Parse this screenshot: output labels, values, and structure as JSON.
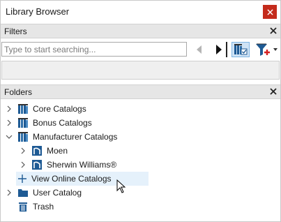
{
  "window": {
    "title": "Library Browser"
  },
  "filters": {
    "header": "Filters",
    "search_placeholder": "Type to start searching..."
  },
  "folders": {
    "header": "Folders",
    "items": [
      {
        "label": "Core Catalogs",
        "expanded": false,
        "icon": "catalog-books-icon"
      },
      {
        "label": "Bonus Catalogs",
        "expanded": false,
        "icon": "catalog-books-icon"
      },
      {
        "label": "Manufacturer Catalogs",
        "expanded": true,
        "icon": "catalog-books-icon"
      },
      {
        "label": "Moen",
        "expanded": false,
        "icon": "manufacturer-icon"
      },
      {
        "label": "Sherwin Williams®",
        "expanded": false,
        "icon": "manufacturer-icon"
      },
      {
        "label": "View Online Catalogs",
        "icon": "plus-icon"
      },
      {
        "label": "User Catalog",
        "expanded": false,
        "icon": "folder-icon"
      },
      {
        "label": "Trash",
        "icon": "trash-icon"
      }
    ]
  },
  "colors": {
    "close_red": "#c42b1c",
    "header_gray": "#e6e6e6",
    "selection_blue": "#e5f1fb",
    "catalog_blue": "#1e5a94"
  }
}
